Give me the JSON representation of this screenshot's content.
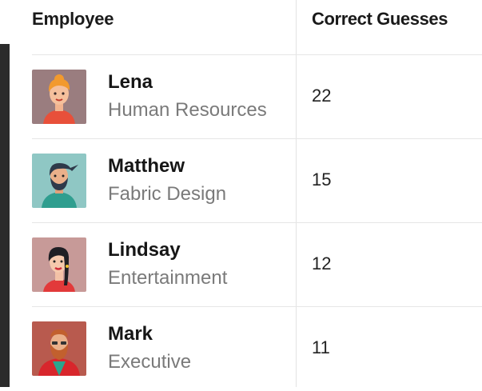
{
  "table": {
    "headers": {
      "employee": "Employee",
      "correct_guesses": "Correct Guesses"
    },
    "rows": [
      {
        "name": "Lena",
        "department": "Human Resources",
        "score": "22",
        "avatar": "avatar-woman-orange-hair-icon"
      },
      {
        "name": "Matthew",
        "department": "Fabric Design",
        "score": "15",
        "avatar": "avatar-man-beard-icon"
      },
      {
        "name": "Lindsay",
        "department": "Entertainment",
        "score": "12",
        "avatar": "avatar-woman-dark-hair-icon"
      },
      {
        "name": "Mark",
        "department": "Executive",
        "score": "11",
        "avatar": "avatar-man-red-beard-icon"
      }
    ]
  }
}
